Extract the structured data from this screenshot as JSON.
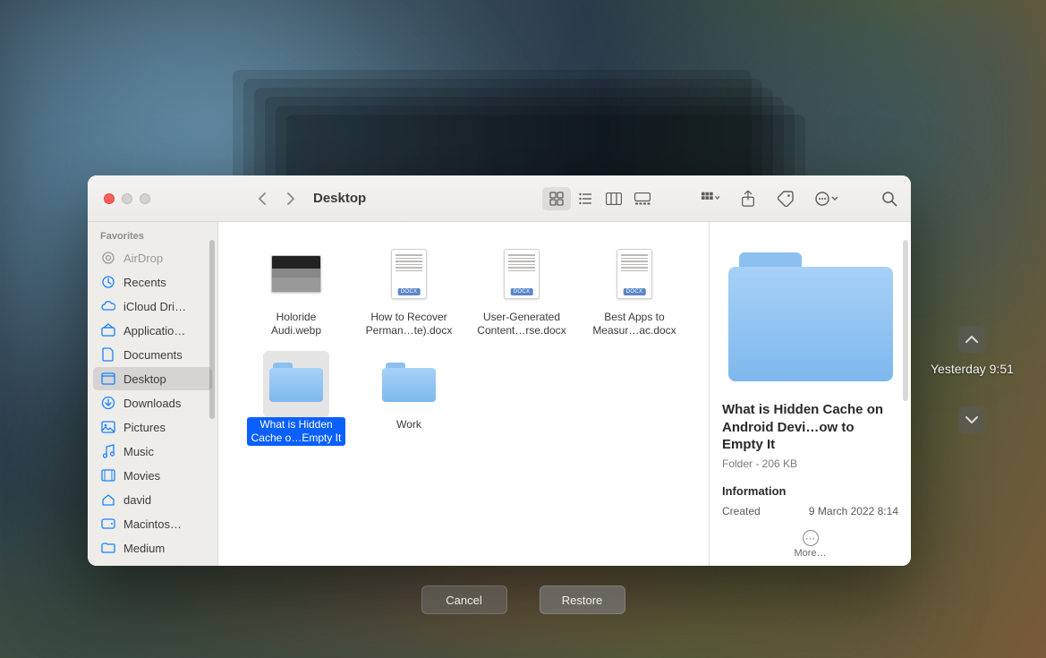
{
  "toolbar": {
    "title": "Desktop"
  },
  "sidebar": {
    "header": "Favorites",
    "items": [
      {
        "label": "AirDrop",
        "icon": "airdrop"
      },
      {
        "label": "Recents",
        "icon": "clock"
      },
      {
        "label": "iCloud Dri…",
        "icon": "cloud"
      },
      {
        "label": "Applicatio…",
        "icon": "apps"
      },
      {
        "label": "Documents",
        "icon": "doc"
      },
      {
        "label": "Desktop",
        "icon": "desktop"
      },
      {
        "label": "Downloads",
        "icon": "download"
      },
      {
        "label": "Pictures",
        "icon": "pictures"
      },
      {
        "label": "Music",
        "icon": "music"
      },
      {
        "label": "Movies",
        "icon": "movies"
      },
      {
        "label": "david",
        "icon": "home"
      },
      {
        "label": "Macintos…",
        "icon": "disk"
      },
      {
        "label": "Medium",
        "icon": "folder"
      }
    ]
  },
  "files": [
    {
      "label": "Holoride Audi.webp",
      "type": "image"
    },
    {
      "label": "How to Recover Perman…te).docx",
      "type": "docx"
    },
    {
      "label": "User-Generated Content…rse.docx",
      "type": "docx"
    },
    {
      "label": "Best Apps to Measur…ac.docx",
      "type": "docx"
    },
    {
      "label": "What is Hidden Cache o…Empty It",
      "type": "folder",
      "selected": true
    },
    {
      "label": "Work",
      "type": "folder"
    }
  ],
  "preview": {
    "title": "What is Hidden Cache on Android Devi…ow to Empty It",
    "subtitle": "Folder - 206 KB",
    "info_header": "Information",
    "created_label": "Created",
    "created_value": "9 March 2022 8:14",
    "more_label": "More…"
  },
  "buttons": {
    "cancel": "Cancel",
    "restore": "Restore"
  },
  "timeline": {
    "label": "Yesterday 9:51"
  }
}
